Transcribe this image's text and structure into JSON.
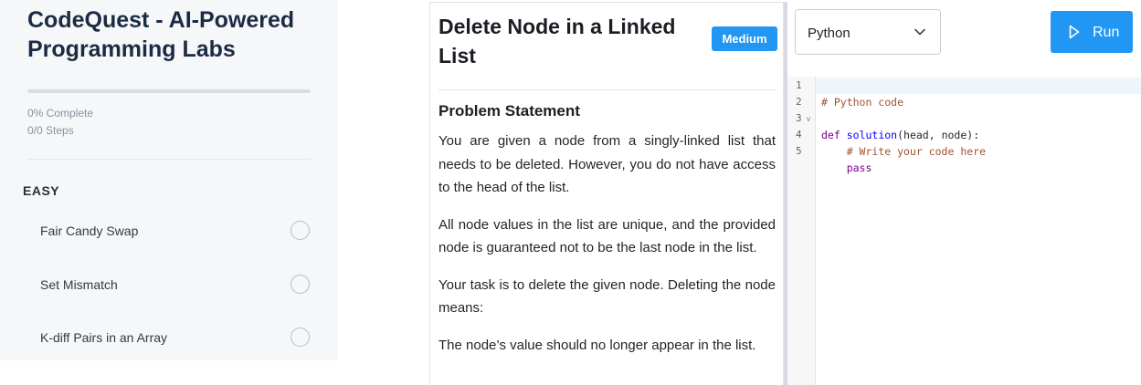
{
  "sidebar": {
    "app_title": "CodeQuest - AI-Powered Programming Labs",
    "progress_percent": 0,
    "progress_label": "0% Complete",
    "steps_label": "0/0 Steps",
    "section_label": "EASY",
    "items": [
      {
        "label": "Fair Candy Swap",
        "completed": false
      },
      {
        "label": "Set Mismatch",
        "completed": false
      },
      {
        "label": "K-diff Pairs in an Array",
        "completed": false
      }
    ]
  },
  "problem": {
    "title": "Delete Node in a Linked List",
    "difficulty": "Medium",
    "section_heading": "Problem Statement",
    "paragraphs": [
      "You are given a node from a singly-linked list that needs to be deleted. However, you do not have access to the head of the list.",
      "All node values in the list are unique, and the provided node is guaranteed not to be the last node in the list.",
      "Your task is to delete the given node. Deleting the node means:",
      "The node’s value should no longer appear in the list."
    ]
  },
  "editor": {
    "language": "Python",
    "run_label": "Run",
    "lines": [
      {
        "number": "1",
        "text": "# Python code"
      },
      {
        "number": "2",
        "text": ""
      },
      {
        "number": "3",
        "text": "def solution(head, node):"
      },
      {
        "number": "4",
        "text": "    # Write your code here"
      },
      {
        "number": "5",
        "text": "    pass"
      }
    ]
  },
  "colors": {
    "accent": "#2196f3",
    "sidebar_bg": "#f6f7f9",
    "title_color": "#1c2b44"
  },
  "icons": {
    "dropdown": "chevron-down-icon",
    "run": "play-icon",
    "step_status": "circle-icon",
    "fold": "fold-arrow-icon"
  }
}
